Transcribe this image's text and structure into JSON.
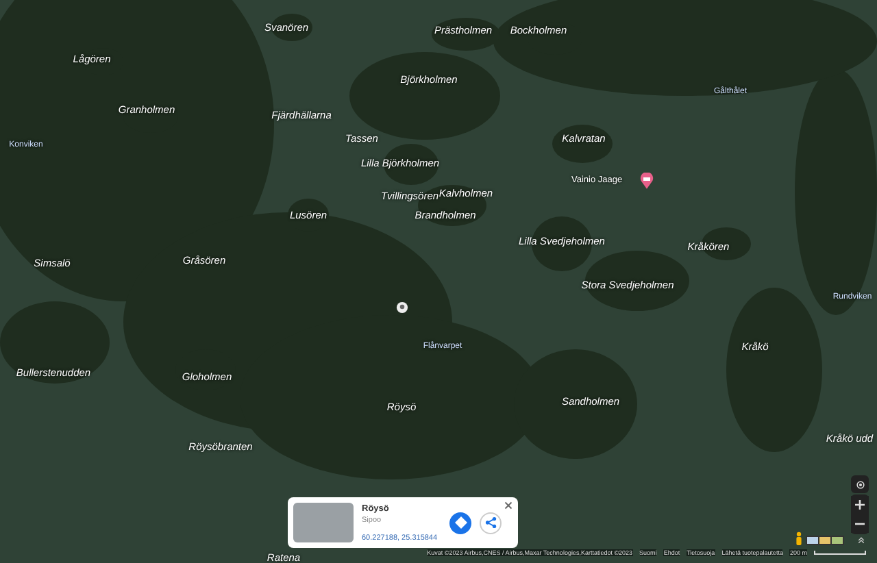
{
  "map": {
    "labels": [
      {
        "text": "Svanören",
        "kind": "island"
      },
      {
        "text": "Prästholmen",
        "kind": "island"
      },
      {
        "text": "Bockholmen",
        "kind": "island"
      },
      {
        "text": "Lågören",
        "kind": "island"
      },
      {
        "text": "Björkholmen",
        "kind": "island"
      },
      {
        "text": "Gålthålet",
        "kind": "place"
      },
      {
        "text": "Granholmen",
        "kind": "island"
      },
      {
        "text": "Fjärdhällarna",
        "kind": "island"
      },
      {
        "text": "Tassen",
        "kind": "island"
      },
      {
        "text": "Konviken",
        "kind": "place"
      },
      {
        "text": "Kalvratan",
        "kind": "island"
      },
      {
        "text": "Lilla Björkholmen",
        "kind": "island"
      },
      {
        "text": "Tvillingsören",
        "kind": "island"
      },
      {
        "text": "Kalvholmen",
        "kind": "island"
      },
      {
        "text": "Lusören",
        "kind": "island"
      },
      {
        "text": "Brandholmen",
        "kind": "island"
      },
      {
        "text": "Lilla Svedjeholmen",
        "kind": "island"
      },
      {
        "text": "Kråkören",
        "kind": "island"
      },
      {
        "text": "Simsalö",
        "kind": "island"
      },
      {
        "text": "Gråsören",
        "kind": "island"
      },
      {
        "text": "Stora Svedjeholmen",
        "kind": "island"
      },
      {
        "text": "Rundviken",
        "kind": "place"
      },
      {
        "text": "Flånvarpet",
        "kind": "place"
      },
      {
        "text": "Kråkö",
        "kind": "island"
      },
      {
        "text": "Bullerstenudden",
        "kind": "island"
      },
      {
        "text": "Gloholmen",
        "kind": "island"
      },
      {
        "text": "Röysö",
        "kind": "island"
      },
      {
        "text": "Sandholmen",
        "kind": "island"
      },
      {
        "text": "Kråkö udd",
        "kind": "island"
      },
      {
        "text": "Röysöbranten",
        "kind": "island"
      },
      {
        "text": "Ratena",
        "kind": "island"
      }
    ],
    "poi": {
      "name": "Vainio Jaage"
    }
  },
  "place_card": {
    "title": "Röysö",
    "subtitle": "Sipoo",
    "coordinates": "60.227188, 25.315844"
  },
  "footer": {
    "attribution": "Kuvat ©2023 Airbus,CNES / Airbus,Maxar Technologies,Karttatiedot ©2023",
    "links": [
      "Suomi",
      "Ehdot",
      "Tietosuoja",
      "Lähetä tuotepalautetta"
    ],
    "scale": "200 m"
  }
}
